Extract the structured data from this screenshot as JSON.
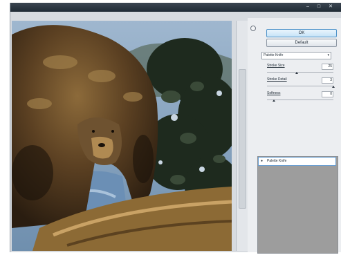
{
  "window": {
    "minimize_label": "–",
    "maximize_label": "□",
    "close_label": "✕"
  },
  "panel": {
    "ok_label": "OK",
    "default_label": "Default",
    "filter_select": {
      "value": "Palette Knife",
      "arrow": "▾"
    },
    "params": [
      {
        "label": "Stroke Size",
        "value": "25",
        "level": 0.45
      },
      {
        "label": "Stroke Detail",
        "value": "3",
        "level": 1.0
      },
      {
        "label": "Softness",
        "value": "0",
        "level": 0.1
      }
    ]
  },
  "layers": {
    "items": [
      {
        "name": "Palette Knife",
        "eye": "●"
      }
    ]
  },
  "colors": {
    "ok_border": "#4f93c9",
    "layer_list_bg": "#9d9d9d",
    "titlebar": "#2a3540"
  }
}
